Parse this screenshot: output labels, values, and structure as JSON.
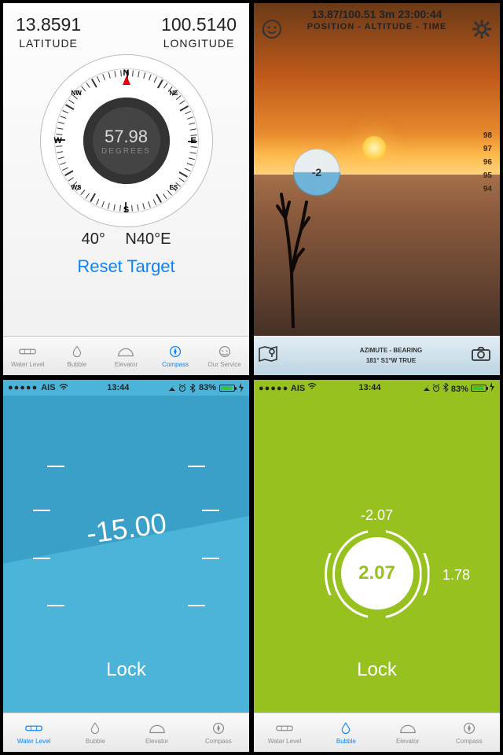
{
  "compass": {
    "latitude_value": "13.8591",
    "latitude_label": "LATITUDE",
    "longitude_value": "100.5140",
    "longitude_label": "LONGITUDE",
    "degrees_value": "57.98",
    "degrees_label": "DEGREES",
    "heading_deg": "40°",
    "heading_cardinal": "N40°E",
    "reset_label": "Reset Target",
    "tabs": [
      {
        "label": "Water Level"
      },
      {
        "label": "Bubble"
      },
      {
        "label": "Elevator"
      },
      {
        "label": "Compass"
      },
      {
        "label": "Our Service"
      }
    ]
  },
  "ar": {
    "position_line": "13.87/100.51  3m 23:00:44",
    "position_label": "POSITION - ALTITUDE - TIME",
    "bubble_value": "-2",
    "scale_values": [
      "98",
      "97",
      "96",
      "95",
      "94"
    ],
    "bottom_label": "AZIMUTE - BEARING",
    "bottom_values": "181°    S1°W    TRUE"
  },
  "waterlevel": {
    "status_carrier": "AIS",
    "status_time": "13:44",
    "status_battery": "83%",
    "value": "-15.00",
    "lock_label": "Lock",
    "tabs": [
      {
        "label": "Water Level"
      },
      {
        "label": "Bubble"
      },
      {
        "label": "Elevator"
      },
      {
        "label": "Compass"
      }
    ]
  },
  "bubble": {
    "status_carrier": "AIS",
    "status_time": "13:44",
    "status_battery": "83%",
    "value_center": "2.07",
    "value_top": "-2.07",
    "value_right": "1.78",
    "lock_label": "Lock",
    "tabs": [
      {
        "label": "Water Level"
      },
      {
        "label": "Bubble"
      },
      {
        "label": "Elevator"
      },
      {
        "label": "Compass"
      }
    ]
  }
}
